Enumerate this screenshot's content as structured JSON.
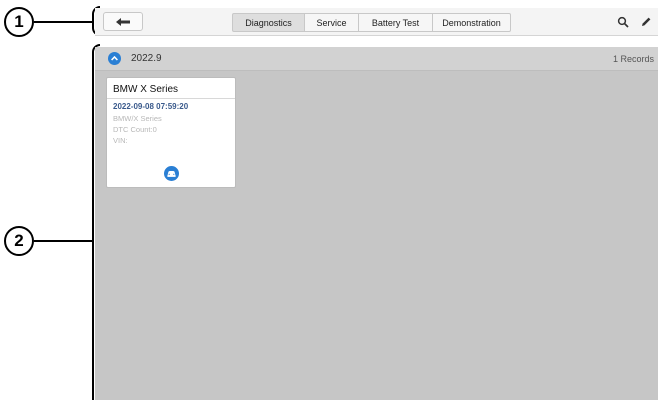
{
  "callouts": {
    "one": "1",
    "two": "2"
  },
  "toolbar": {
    "tabs": [
      "Diagnostics",
      "Service",
      "Battery Test",
      "Demonstration"
    ],
    "active_tab": "Diagnostics"
  },
  "group": {
    "title": "2022.9",
    "count": "1 Records"
  },
  "card": {
    "title": "BMW X Series",
    "date": "2022-09-08 07:59:20",
    "model": "BMW/X Series",
    "dtc": "DTC Count:0",
    "vin": "VIN:"
  },
  "colors": {
    "accent": "#2a7fd4",
    "content_bg": "#c6c6c6",
    "date_text": "#3a5a8c"
  },
  "icons": {
    "back": "arrow-left-icon",
    "search": "search-icon",
    "edit": "edit-icon",
    "collapse": "chevron-up-icon",
    "vehicle": "car-icon"
  }
}
